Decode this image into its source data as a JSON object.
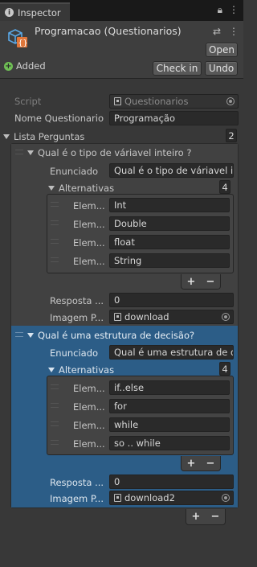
{
  "tab": {
    "title": "Inspector",
    "icon": "info-icon"
  },
  "object": {
    "name": "Programacao (Questionarios)",
    "open_label": "Open",
    "status": "Added",
    "checkin_label": "Check in",
    "undo_label": "Undo"
  },
  "fields": {
    "script_label": "Script",
    "script_value": "Questionarios",
    "nome_label": "Nome Questionario",
    "nome_value": "Programação",
    "lista_label": "Lista Perguntas",
    "lista_count": "2"
  },
  "questions": [
    {
      "title": "Qual é o tipo de váriavel inteiro ?",
      "enunciado_label": "Enunciado",
      "enunciado_value": "Qual é o tipo de váriavel inteiro ?",
      "alternativas_label": "Alternativas",
      "alternativas_count": "4",
      "element_label": "Elem...",
      "alternatives": [
        "Int",
        "Double",
        "float",
        "String"
      ],
      "resposta_label": "Resposta ...",
      "resposta_value": "0",
      "imagem_label": "Imagem P...",
      "imagem_value": "download"
    },
    {
      "title": "Qual é uma estrutura de decisão?",
      "enunciado_label": "Enunciado",
      "enunciado_value": "Qual é uma estrutura de decisão?",
      "alternativas_label": "Alternativas",
      "alternativas_count": "4",
      "element_label": "Elem...",
      "alternatives": [
        "if..else",
        "for",
        "while",
        "so .. while"
      ],
      "resposta_label": "Resposta ...",
      "resposta_value": "0",
      "imagem_label": "Imagem P...",
      "imagem_value": "download2"
    }
  ],
  "buttons": {
    "plus": "+",
    "minus": "−"
  },
  "colors": {
    "selection": "#2c5d87",
    "added": "#6fbf55"
  }
}
